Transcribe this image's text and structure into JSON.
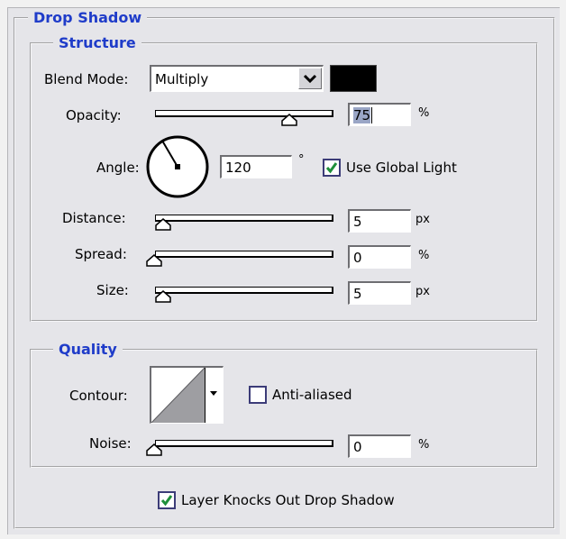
{
  "panel": {
    "title": "Drop Shadow"
  },
  "structure": {
    "legend": "Structure",
    "blend_mode": {
      "label": "Blend Mode:",
      "value": "Multiply",
      "swatch_color": "#000000"
    },
    "opacity": {
      "label": "Opacity:",
      "value": "75",
      "unit": "%",
      "level": 0.75
    },
    "angle": {
      "label": "Angle:",
      "value": "120",
      "unit": "°",
      "degrees": 120,
      "use_global_light": {
        "label": "Use Global Light",
        "checked": true
      }
    },
    "distance": {
      "label": "Distance:",
      "value": "5",
      "unit": "px",
      "level": 0.02
    },
    "spread": {
      "label": "Spread:",
      "value": "0",
      "unit": "%",
      "level": 0.0
    },
    "size": {
      "label": "Size:",
      "value": "5",
      "unit": "px",
      "level": 0.02
    }
  },
  "quality": {
    "legend": "Quality",
    "contour": {
      "label": "Contour:"
    },
    "anti_aliased": {
      "label": "Anti-aliased",
      "checked": false
    },
    "noise": {
      "label": "Noise:",
      "value": "0",
      "unit": "%",
      "level": 0.0
    }
  },
  "layer_knocks_out": {
    "label": "Layer Knocks Out Drop Shadow",
    "checked": true
  },
  "colors": {
    "legend_blue": "#1f3cc9",
    "check_green": "#1f8f3a",
    "panel_bg": "#e5e5e9"
  }
}
